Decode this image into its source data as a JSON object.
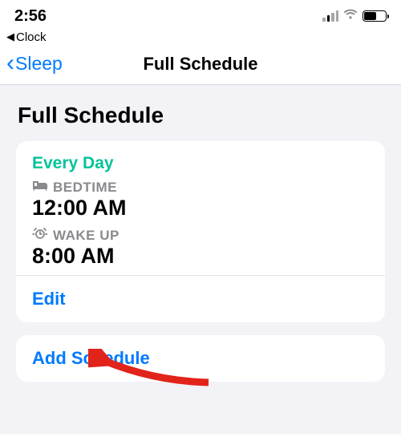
{
  "status_bar": {
    "time": "2:56",
    "breadcrumb": "Clock"
  },
  "nav": {
    "back_label": "Sleep",
    "title": "Full Schedule"
  },
  "page": {
    "title": "Full Schedule"
  },
  "schedule": {
    "day_label": "Every Day",
    "bedtime_label": "BEDTIME",
    "bedtime_value": "12:00 AM",
    "wakeup_label": "WAKE UP",
    "wakeup_value": "8:00 AM",
    "edit_label": "Edit"
  },
  "actions": {
    "add_schedule": "Add Schedule"
  },
  "colors": {
    "accent_blue": "#007aff",
    "accent_teal": "#02c39a",
    "muted_gray": "#8a8a8e",
    "bg_gray": "#f2f2f7"
  }
}
